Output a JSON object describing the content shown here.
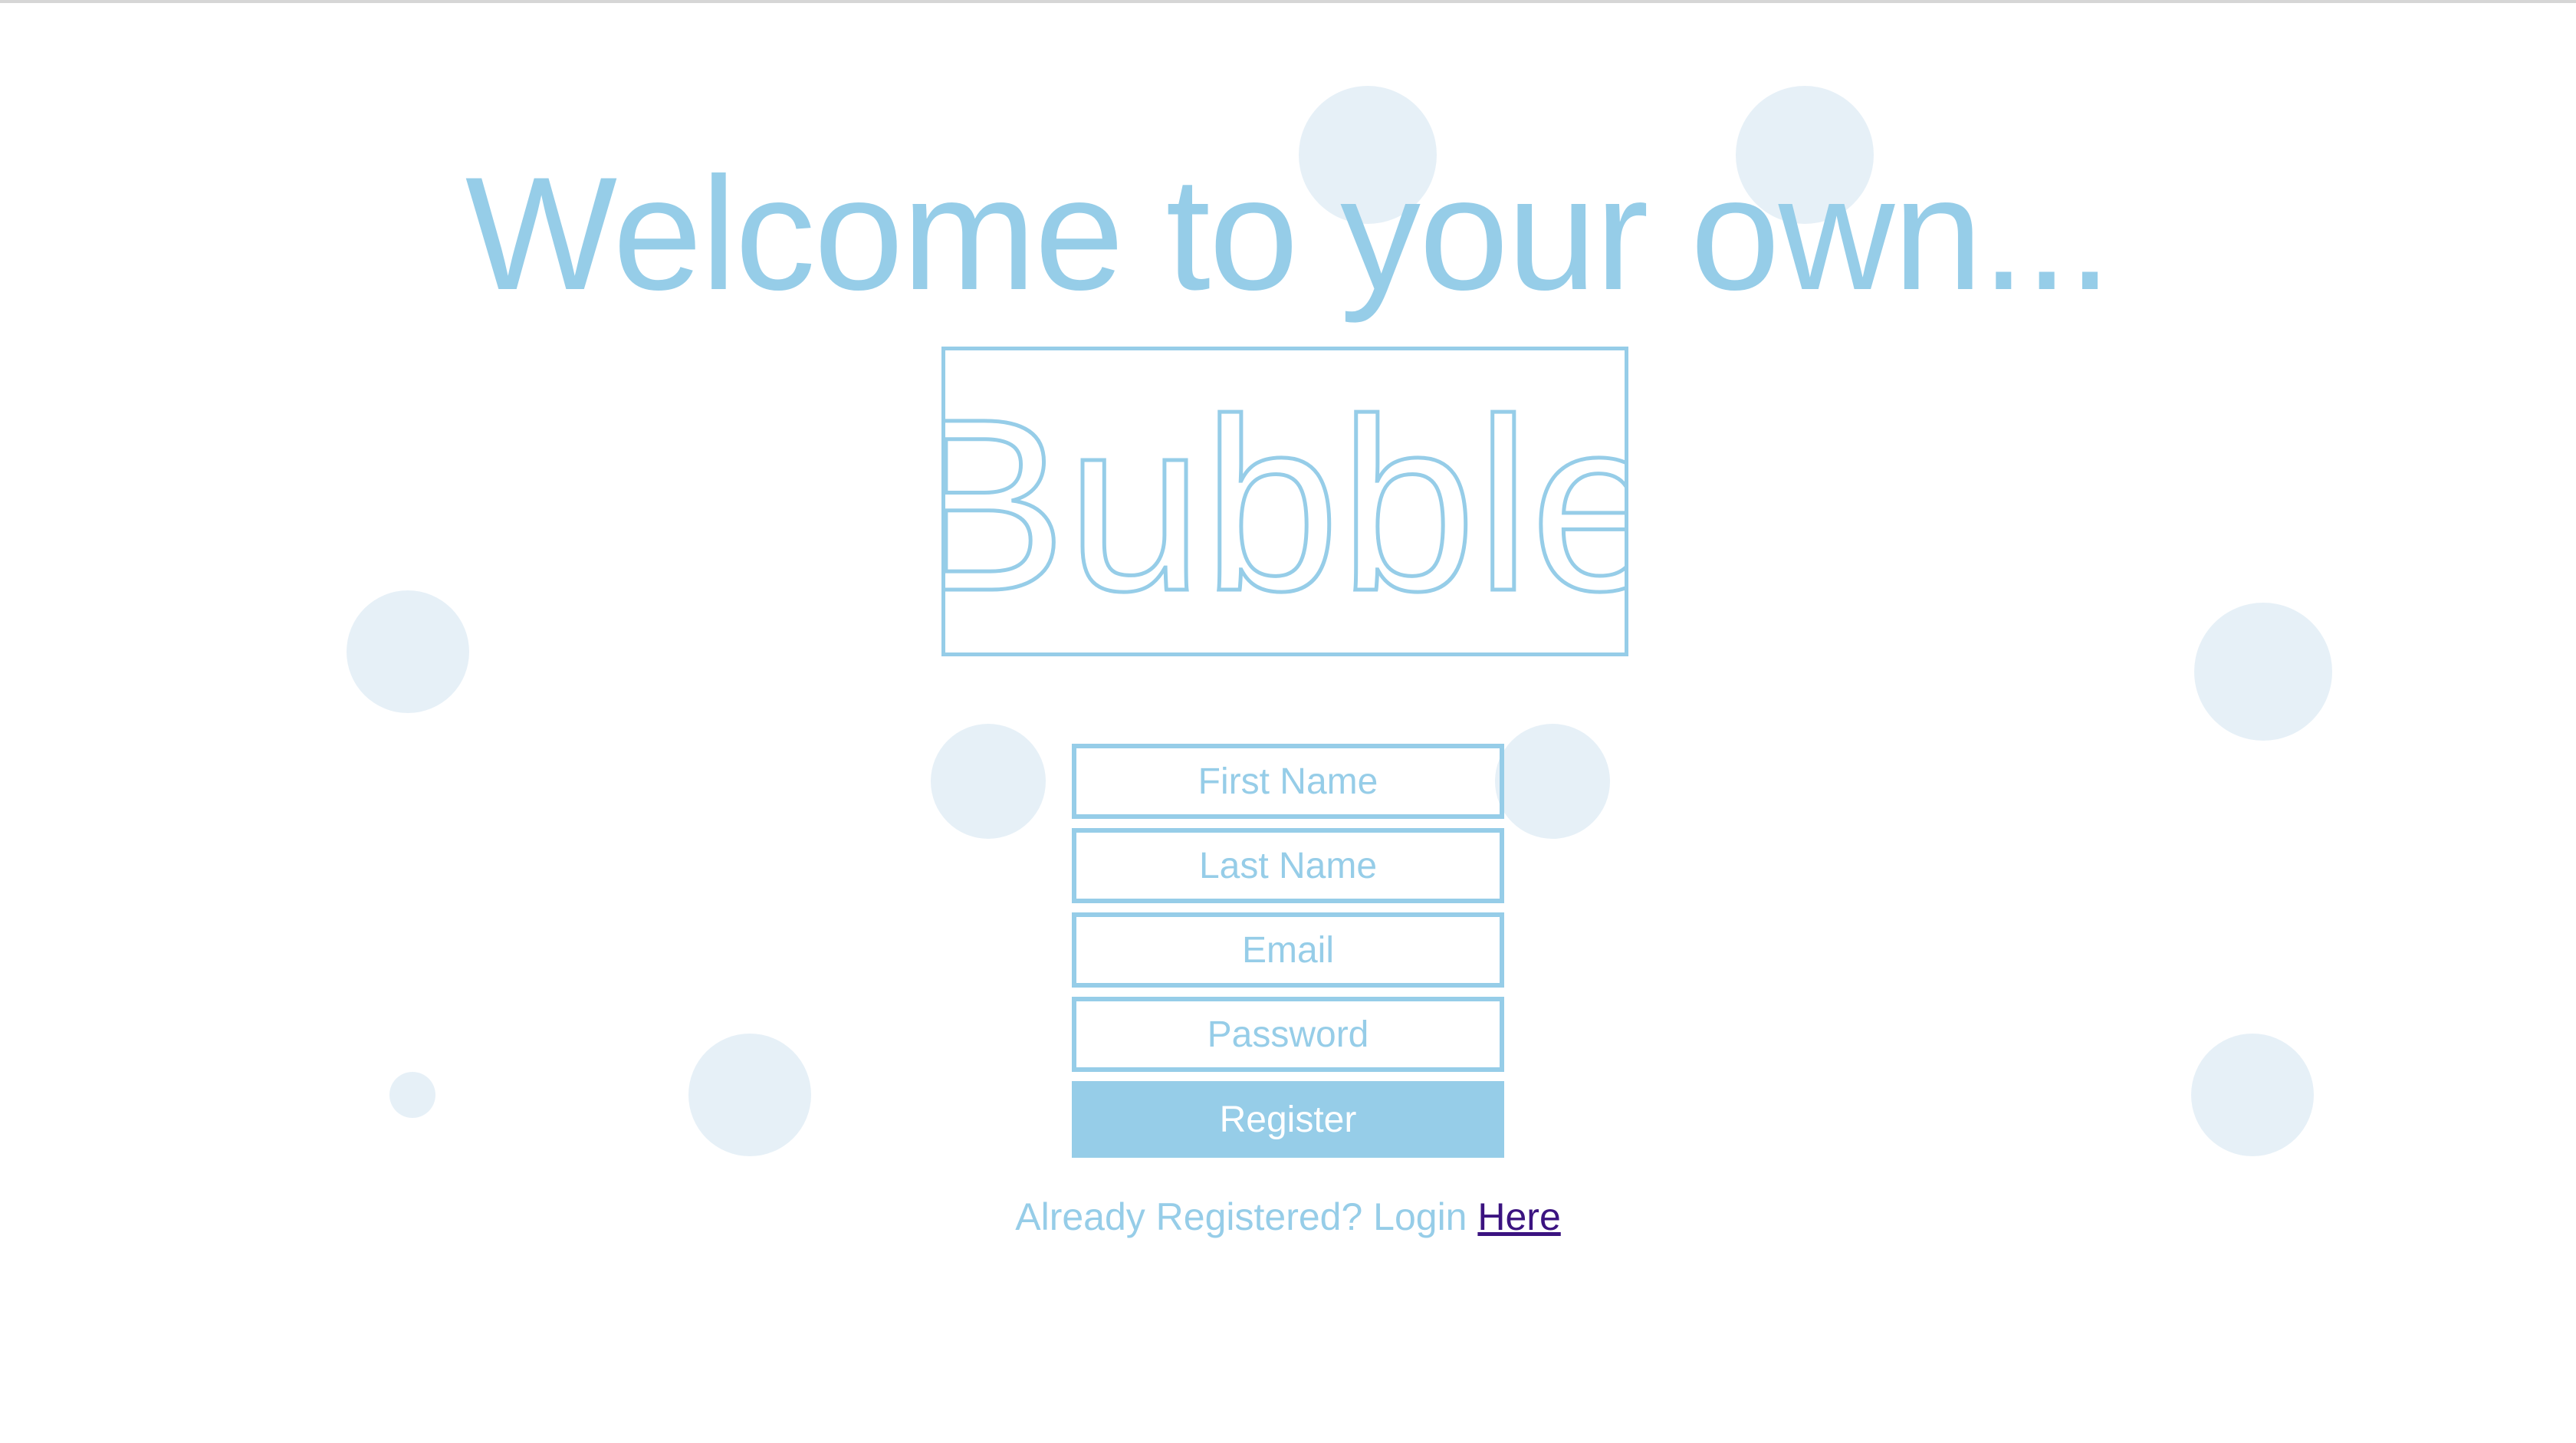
{
  "header": {
    "welcome_text": "Welcome to your own..."
  },
  "logo": {
    "text": "Bubble"
  },
  "form": {
    "first_name": {
      "placeholder": "First Name",
      "value": ""
    },
    "last_name": {
      "placeholder": "Last Name",
      "value": ""
    },
    "email": {
      "placeholder": "Email",
      "value": ""
    },
    "password": {
      "placeholder": "Password",
      "value": ""
    },
    "register_label": "Register"
  },
  "footer": {
    "prompt": "Already Registered? Login ",
    "link_label": "Here"
  },
  "colors": {
    "accent": "#96cde8",
    "link": "#3b1380",
    "bubble": "#d8e8f2",
    "background": "#ffffff"
  }
}
